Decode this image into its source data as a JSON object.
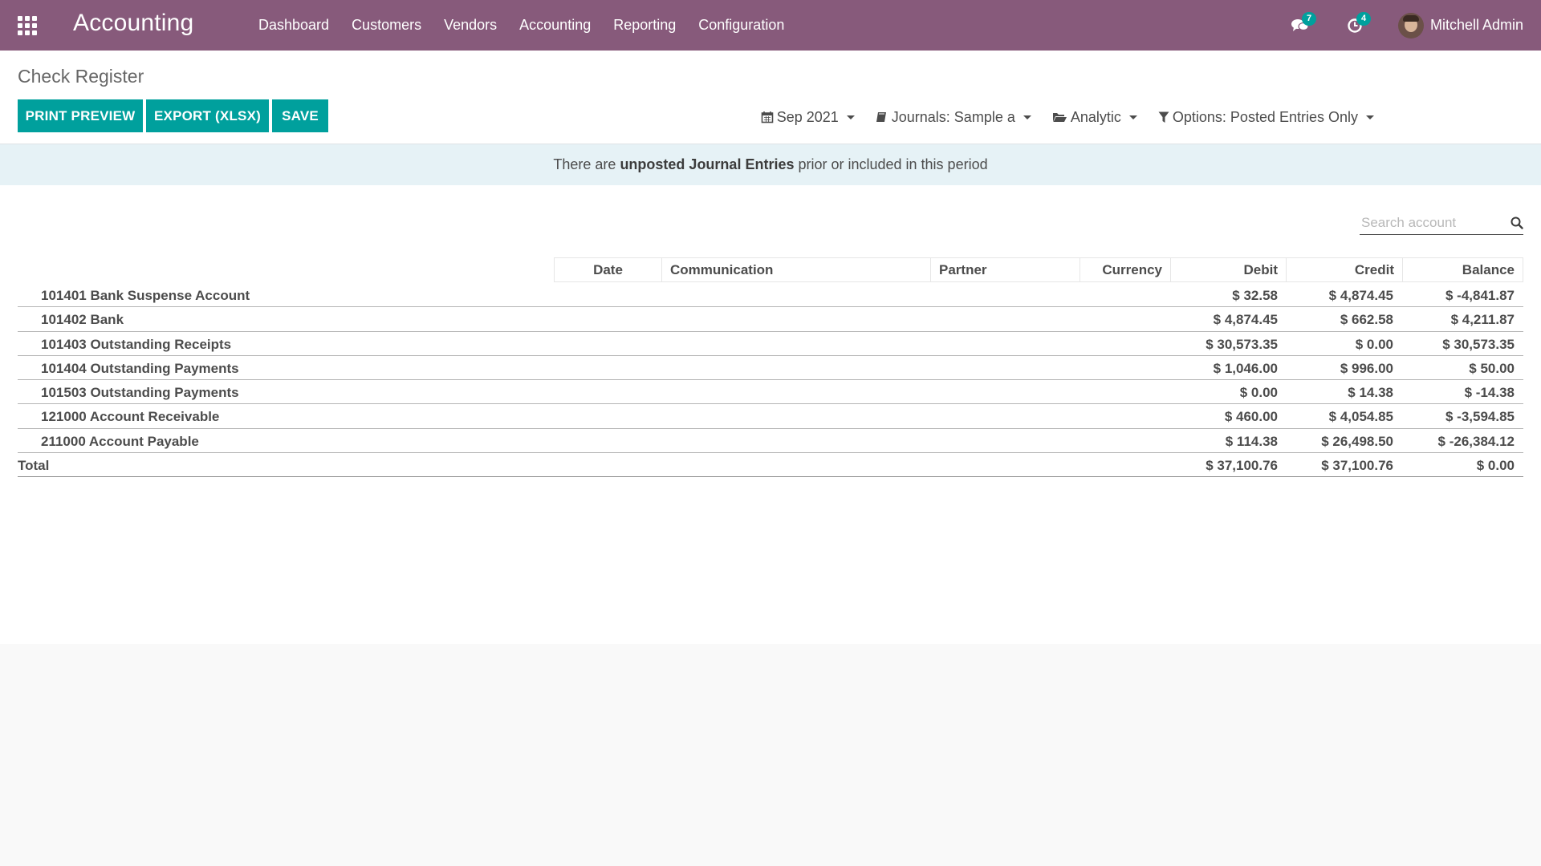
{
  "navbar": {
    "apps_icon": "apps-grid-icon",
    "brand": "Accounting",
    "menu": [
      "Dashboard",
      "Customers",
      "Vendors",
      "Accounting",
      "Reporting",
      "Configuration"
    ],
    "messages_badge": "7",
    "activities_badge": "4",
    "user_name": "Mitchell Admin"
  },
  "control": {
    "breadcrumb": "Check Register",
    "buttons": {
      "print_preview": "PRINT PREVIEW",
      "export": "EXPORT (XLSX)",
      "save": "SAVE"
    },
    "filters": {
      "date": "Sep 2021",
      "journals": "Journals: Sample a",
      "analytic": "Analytic",
      "options": "Options: Posted Entries Only"
    }
  },
  "alert": {
    "prefix": "There are ",
    "bold": "unposted Journal Entries",
    "suffix": " prior or included in this period"
  },
  "search": {
    "placeholder": "Search account"
  },
  "table": {
    "columns": {
      "date": "Date",
      "communication": "Communication",
      "partner": "Partner",
      "currency": "Currency",
      "debit": "Debit",
      "credit": "Credit",
      "balance": "Balance"
    },
    "rows": [
      {
        "account": "101401 Bank Suspense Account",
        "debit": "$ 32.58",
        "credit": "$ 4,874.45",
        "balance": "$ -4,841.87"
      },
      {
        "account": "101402 Bank",
        "debit": "$ 4,874.45",
        "credit": "$ 662.58",
        "balance": "$ 4,211.87"
      },
      {
        "account": "101403 Outstanding Receipts",
        "debit": "$ 30,573.35",
        "credit": "$ 0.00",
        "balance": "$ 30,573.35"
      },
      {
        "account": "101404 Outstanding Payments",
        "debit": "$ 1,046.00",
        "credit": "$ 996.00",
        "balance": "$ 50.00"
      },
      {
        "account": "101503 Outstanding Payments",
        "debit": "$ 0.00",
        "credit": "$ 14.38",
        "balance": "$ -14.38"
      },
      {
        "account": "121000 Account Receivable",
        "debit": "$ 460.00",
        "credit": "$ 4,054.85",
        "balance": "$ -3,594.85"
      },
      {
        "account": "211000 Account Payable",
        "debit": "$ 114.38",
        "credit": "$ 26,498.50",
        "balance": "$ -26,384.12"
      }
    ],
    "total": {
      "label": "Total",
      "debit": "$ 37,100.76",
      "credit": "$ 37,100.76",
      "balance": "$ 0.00"
    }
  },
  "colors": {
    "navbar": "#875a7b",
    "primary_button": "#00a09d",
    "alert_bg": "#e6f2f6"
  }
}
